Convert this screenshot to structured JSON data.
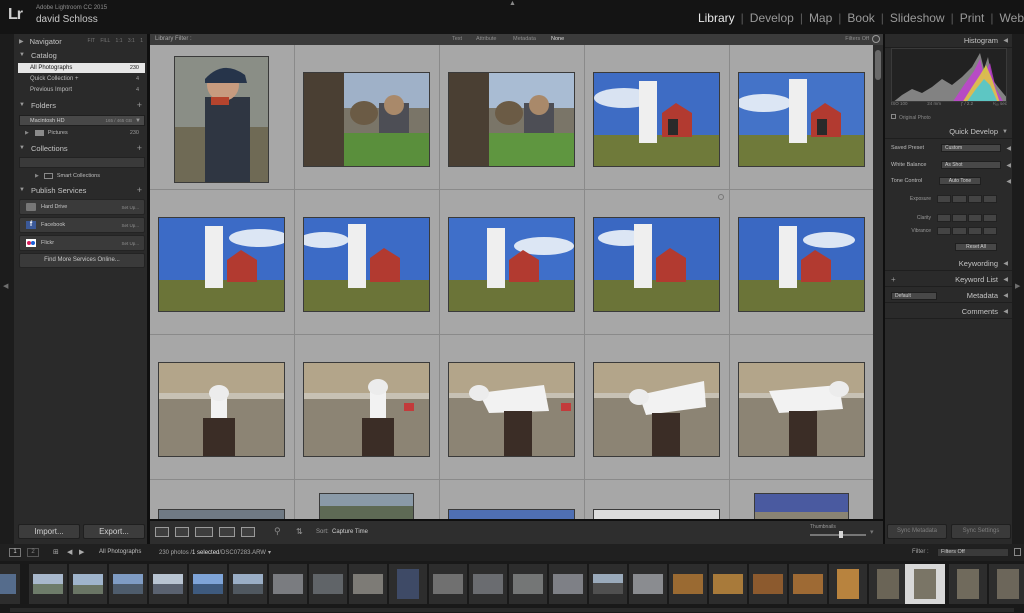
{
  "topbar": {
    "logo": "Lr",
    "app_name": "Adobe Lightroom CC 2015",
    "user_name": "david Schloss",
    "modules": [
      "Library",
      "Develop",
      "Map",
      "Book",
      "Slideshow",
      "Print",
      "Web"
    ],
    "active_module": "Library"
  },
  "left": {
    "navigator": {
      "title": "Navigator",
      "modes": "FIT  FILL  1:1  3:1  1"
    },
    "catalog": {
      "title": "Catalog",
      "items": [
        {
          "label": "All Photographs",
          "count": "230"
        },
        {
          "label": "Quick Collection +",
          "count": "4"
        },
        {
          "label": "Previous Import",
          "count": "4"
        }
      ]
    },
    "folders": {
      "title": "Folders",
      "volume": "Macintosh HD",
      "volume_meta": "165 / 465 GB",
      "sub": "Pictures",
      "sub_count": "230"
    },
    "collections": {
      "title": "Collections",
      "smart": "Smart Collections"
    },
    "publish": {
      "title": "Publish Services",
      "services": [
        {
          "label": "Hard Drive",
          "action": "Set Up..."
        },
        {
          "label": "Facebook",
          "action": "Set Up..."
        },
        {
          "label": "Flickr",
          "action": "Set Up..."
        }
      ],
      "find_more": "Find More Services Online..."
    },
    "import_label": "Import...",
    "export_label": "Export..."
  },
  "filter": {
    "label": "Library Filter :",
    "options": [
      "Text",
      "Attribute",
      "Metadata",
      "None"
    ],
    "active": "None",
    "filters_off": "Filters Off"
  },
  "toolbar": {
    "sort_label": "Sort:",
    "sort_value": "Capture Time",
    "thumbnails_label": "Thumbnails",
    "thumbnail_size": 0.55
  },
  "right": {
    "histogram": {
      "title": "Histogram",
      "iso": "ISO 100",
      "focal": "24 mm",
      "aperture": "ƒ / 2.2",
      "shutter": "¹⁄₆₀ sec"
    },
    "original_photo": "Original Photo",
    "quick_develop": {
      "title": "Quick Develop",
      "saved_preset_label": "Saved Preset",
      "saved_preset_value": "Custom",
      "white_balance_label": "White Balance",
      "white_balance_value": "As Shot",
      "tone_control_label": "Tone Control",
      "auto_tone": "Auto Tone",
      "exposure_label": "Exposure",
      "clarity_label": "Clarity",
      "vibrance_label": "Vibrance",
      "reset_all": "Reset All"
    },
    "keywording": "Keywording",
    "keyword_list": "Keyword List",
    "metadata": "Metadata",
    "metadata_preset": "Default",
    "comments": "Comments",
    "sync_metadata": "Sync Metadata",
    "sync_settings": "Sync Settings"
  },
  "filmstrip_bar": {
    "pages": [
      "1",
      "2"
    ],
    "source": "All Photographs",
    "count_text": "230 photos /",
    "selected_text": "1 selected",
    "file_text": "/DSC07283.ARW",
    "filter_label": "Filter :",
    "filter_value": "Filters Off"
  },
  "colors": {
    "accent_selected": "#e6e6e6",
    "grid_cell": "#a7a7a7",
    "panel": "#2a2a2a"
  }
}
